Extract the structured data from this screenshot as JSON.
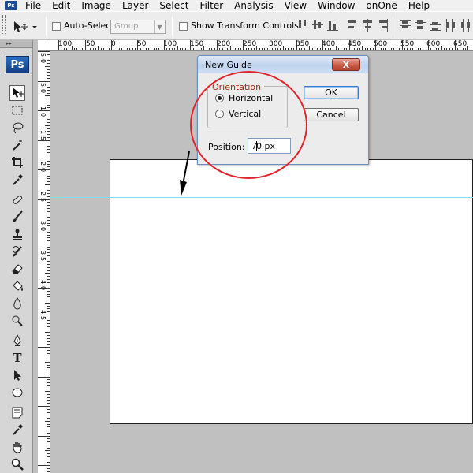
{
  "menu": {
    "app_icon": "Ps",
    "items": [
      "File",
      "Edit",
      "Image",
      "Layer",
      "Select",
      "Filter",
      "Analysis",
      "View",
      "Window",
      "onOne",
      "Help"
    ]
  },
  "options_bar": {
    "auto_select_label": "Auto-Select:",
    "auto_select_checked": false,
    "group_select_value": "Group",
    "show_transform_label": "Show Transform Controls",
    "show_transform_checked": false
  },
  "toolbox": {
    "logo": "Ps",
    "tools": [
      "move-icon",
      "marquee-icon",
      "lasso-icon",
      "magic-wand-icon",
      "crop-icon",
      "eyedropper-icon",
      "healing-brush-icon",
      "brush-icon",
      "clone-stamp-icon",
      "history-brush-icon",
      "eraser-icon",
      "paint-bucket-icon",
      "blur-icon",
      "dodge-icon",
      "pen-icon",
      "type-icon",
      "path-selection-icon",
      "shape-icon",
      "notes-icon",
      "eyedropper2-icon",
      "hand-icon",
      "zoom-icon"
    ],
    "type_glyph": "T"
  },
  "rulers": {
    "top_labels": [
      "100",
      "50",
      "0",
      "50",
      "100",
      "150",
      "200",
      "250",
      "300",
      "350",
      "400",
      "450",
      "500",
      "550",
      "600",
      "650"
    ],
    "left_labels": [
      "5",
      "0",
      "5",
      "0",
      "1",
      "0",
      "1",
      "5",
      "2",
      "0",
      "2",
      "5",
      "3",
      "0",
      "3",
      "5",
      "4",
      "0",
      "4",
      "5"
    ]
  },
  "dialog": {
    "title": "New Guide",
    "close_glyph": "X",
    "orientation_legend": "Orientation",
    "horizontal_label": "Horizontal",
    "vertical_label": "Vertical",
    "selected_orientation": "Horizontal",
    "ok_label": "OK",
    "cancel_label": "Cancel",
    "position_label": "Position:",
    "position_value_before_caret": "7",
    "position_value_after_caret": "0 px"
  },
  "colors": {
    "guide": "#7fe0e8",
    "annotation": "#e3232c",
    "legend_text": "#9b2d12",
    "ps_blue": "#1d4b8f"
  }
}
